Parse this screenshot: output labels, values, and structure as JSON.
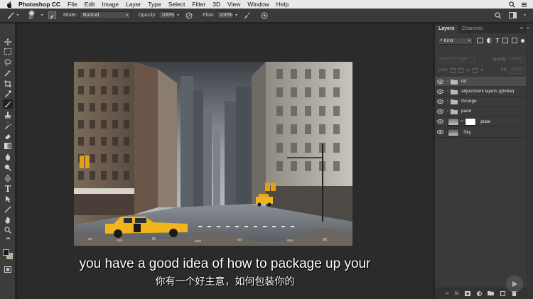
{
  "menubar": {
    "app": "Photoshop CC",
    "items": [
      "File",
      "Edit",
      "Image",
      "Layer",
      "Type",
      "Select",
      "Filter",
      "3D",
      "View",
      "Window",
      "Help"
    ]
  },
  "options_bar": {
    "brush_size": "30",
    "mode_label": "Mode:",
    "mode_value": "Normal",
    "opacity_label": "Opacity:",
    "opacity_value": "100%",
    "flow_label": "Flow:",
    "flow_value": "100%"
  },
  "panel": {
    "tabs": [
      "Layers",
      "Channels"
    ],
    "filter_kind": "Kind",
    "blend_mode": "Pass Through",
    "opacity_label": "Opacity:",
    "opacity_value": "100%",
    "lock_label": "Lock:",
    "fill_label": "Fill:",
    "fill_value": "100%",
    "layers": [
      {
        "name": "ref",
        "type": "group",
        "selected": true
      },
      {
        "name": "adjustment layers (global)",
        "type": "group"
      },
      {
        "name": "Grunge",
        "type": "group"
      },
      {
        "name": "paint",
        "type": "group"
      },
      {
        "name": "plate",
        "type": "masked"
      },
      {
        "name": "Sky",
        "type": "image"
      }
    ]
  },
  "subtitles": {
    "en": "you have a good idea of how to package up your",
    "zh": "你有一个好主意，如何包装你的"
  },
  "colors": {
    "foreground": "#1b1b1b",
    "background": "#9bc27a",
    "taxi": "#f0b41c"
  }
}
